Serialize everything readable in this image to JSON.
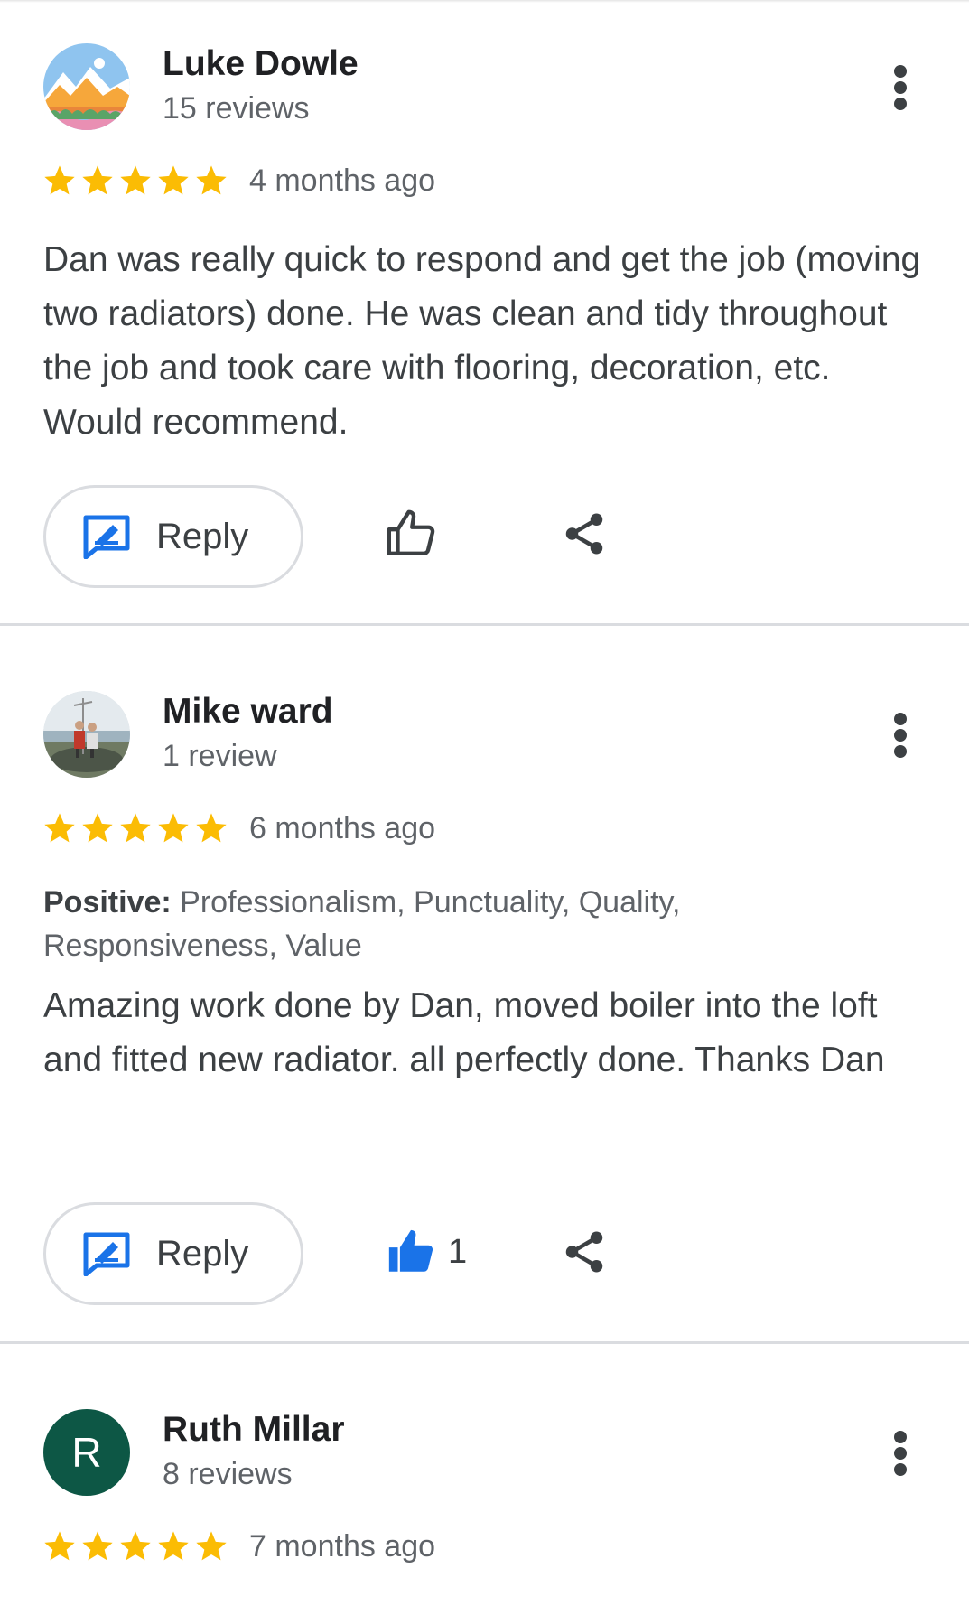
{
  "reviews": [
    {
      "author": "Luke Dowle",
      "review_count": "15 reviews",
      "avatar": "landscape-photo",
      "rating": 5,
      "time_ago": "4 months ago",
      "text": "Dan was really quick to respond and get the job (moving two radiators) done. He was clean and tidy throughout the job and took care with flooring, decoration, etc. Would recommend.",
      "reply_label": "Reply",
      "like_count": "",
      "liked": false
    },
    {
      "author": "Mike ward",
      "review_count": "1 review",
      "avatar": "person-photo",
      "rating": 5,
      "time_ago": "6 months ago",
      "positive_label": "Positive:",
      "positive_values": " Professionalism, Punctuality, Quality, Responsiveness, Value",
      "text": "Amazing work done by Dan, moved boiler into the loft and fitted new radiator. all perfectly done. Thanks Dan",
      "reply_label": "Reply",
      "like_count": "1",
      "liked": true
    },
    {
      "author": "Ruth Millar",
      "review_count": "8 reviews",
      "avatar_letter": "R",
      "avatar_color": "#0d5745",
      "rating": 5,
      "time_ago": "7 months ago"
    }
  ],
  "colors": {
    "star": "#fbbc04",
    "accent_blue": "#1a73e8",
    "divider": "#dadce0"
  },
  "icons": [
    "more-vert-icon",
    "star-icon",
    "reply-icon",
    "thumb-up-icon",
    "share-icon"
  ]
}
